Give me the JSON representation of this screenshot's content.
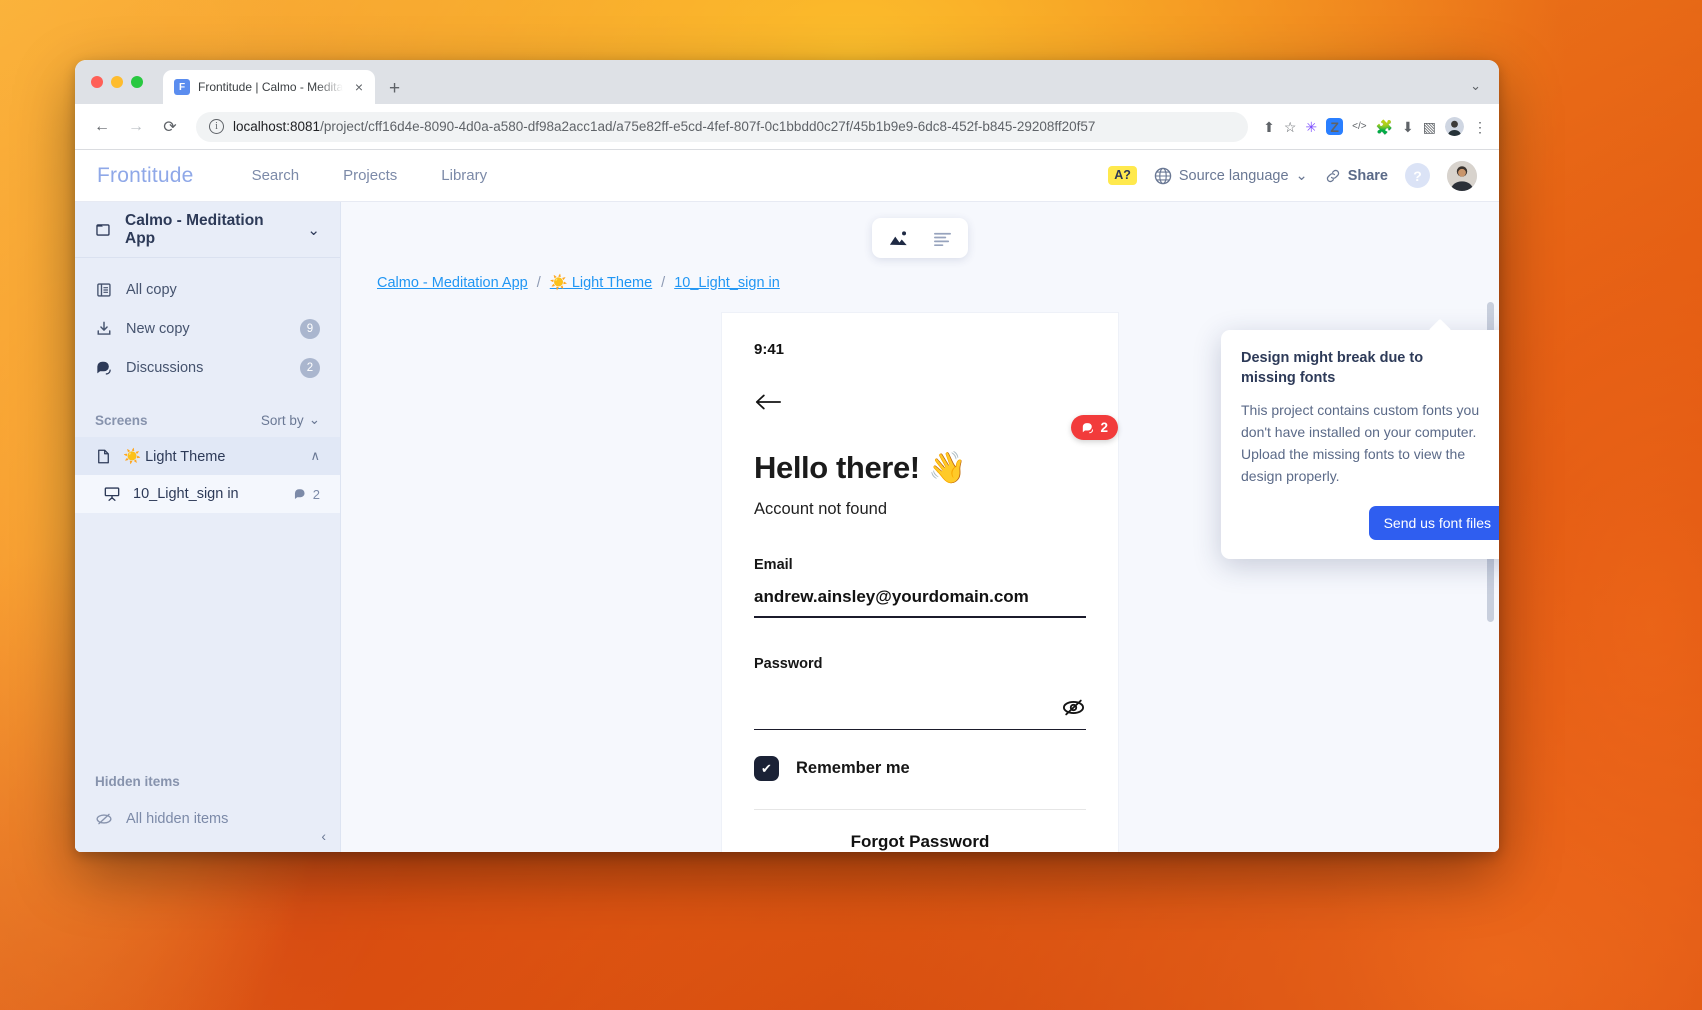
{
  "browser": {
    "tab": {
      "title": "Frontitude | Calmo - Meditatio",
      "favicon_letter": "F",
      "close_icon": "×"
    },
    "new_tab_icon": "+",
    "window_chevron_icon": "⌄",
    "back_icon": "←",
    "forward_icon": "→",
    "reload_icon": "⟳",
    "info_icon": "i",
    "url_host": "localhost:8081",
    "url_path": "/project/cff16d4e-8090-4d0a-a580-df98a2acc1ad/a75e82ff-e5cd-4fef-807f-0c1bbdd0c27f/45b1b9e9-6dc8-452f-b845-29208ff20f57",
    "extensions": {
      "share_icon": "⬆",
      "bookmark_icon": "☆",
      "puzzle_icon": "🧩",
      "download_icon": "⬇",
      "sidepanel_icon": "▧",
      "menu_icon": "⋮",
      "zeplin_label": "Z",
      "zeplin_color": "#2a7fff",
      "code_label": "</>",
      "asterisk_label": "✳"
    }
  },
  "header": {
    "logo": "Frontitude",
    "nav": [
      {
        "label": "Search"
      },
      {
        "label": "Projects"
      },
      {
        "label": "Library"
      }
    ],
    "font_badge": "A?",
    "font_badge_color": "#ffe94d",
    "source_language": "Source language",
    "globe_icon": "🌐",
    "chevron_down_icon": "⌄",
    "share": "Share",
    "share_icon": "∿",
    "help_icon": "?"
  },
  "sidebar": {
    "project": {
      "name": "Calmo - Meditation App",
      "folder_icon": "🗀",
      "chevron_icon": "⌄"
    },
    "items": [
      {
        "label": "All copy",
        "icon": "document-icon",
        "count": ""
      },
      {
        "label": "New copy",
        "icon": "import-icon",
        "count": "9"
      },
      {
        "label": "Discussions",
        "icon": "comment-icon",
        "count": "2"
      }
    ],
    "screens_section": {
      "title": "Screens",
      "sort_label": "Sort by"
    },
    "screen_group": {
      "label": "Light Theme",
      "emoji": "☀️",
      "chevron_icon": "∧"
    },
    "screens": [
      {
        "label": "10_Light_sign in",
        "comments": "2"
      }
    ],
    "hidden_section": {
      "title": "Hidden items",
      "item": "All hidden items"
    },
    "collapse_icon": "‹"
  },
  "canvas": {
    "view_toggle": {
      "image_view": "image-view",
      "text_view": "text-view"
    },
    "breadcrumb": [
      {
        "label": "Calmo - Meditation App"
      },
      {
        "label": "☀️ Light Theme"
      },
      {
        "label": "10_Light_sign in"
      }
    ],
    "breadcrumb_sep": "/"
  },
  "design": {
    "status_time": "9:41",
    "back_icon": "←",
    "comment_badge": {
      "count": "2",
      "icon": "💬"
    },
    "title": "Hello there! 👋",
    "subtitle": "Account not found",
    "email_label": "Email",
    "email_value": "andrew.ainsley@yourdomain.com",
    "password_label": "Password",
    "password_value": "",
    "eye_off_icon": "eye-off-icon",
    "remember_label": "Remember me",
    "remember_checked_icon": "✔",
    "forgot_password": "Forgot Password"
  },
  "popover": {
    "title": "Design might break due to missing fonts",
    "body": "This project contains custom fonts you don't have installed on your computer. Upload the missing fonts to view the design properly.",
    "button": "Send us font files",
    "button_color": "#2f5ef0",
    "close_icon": "×"
  }
}
